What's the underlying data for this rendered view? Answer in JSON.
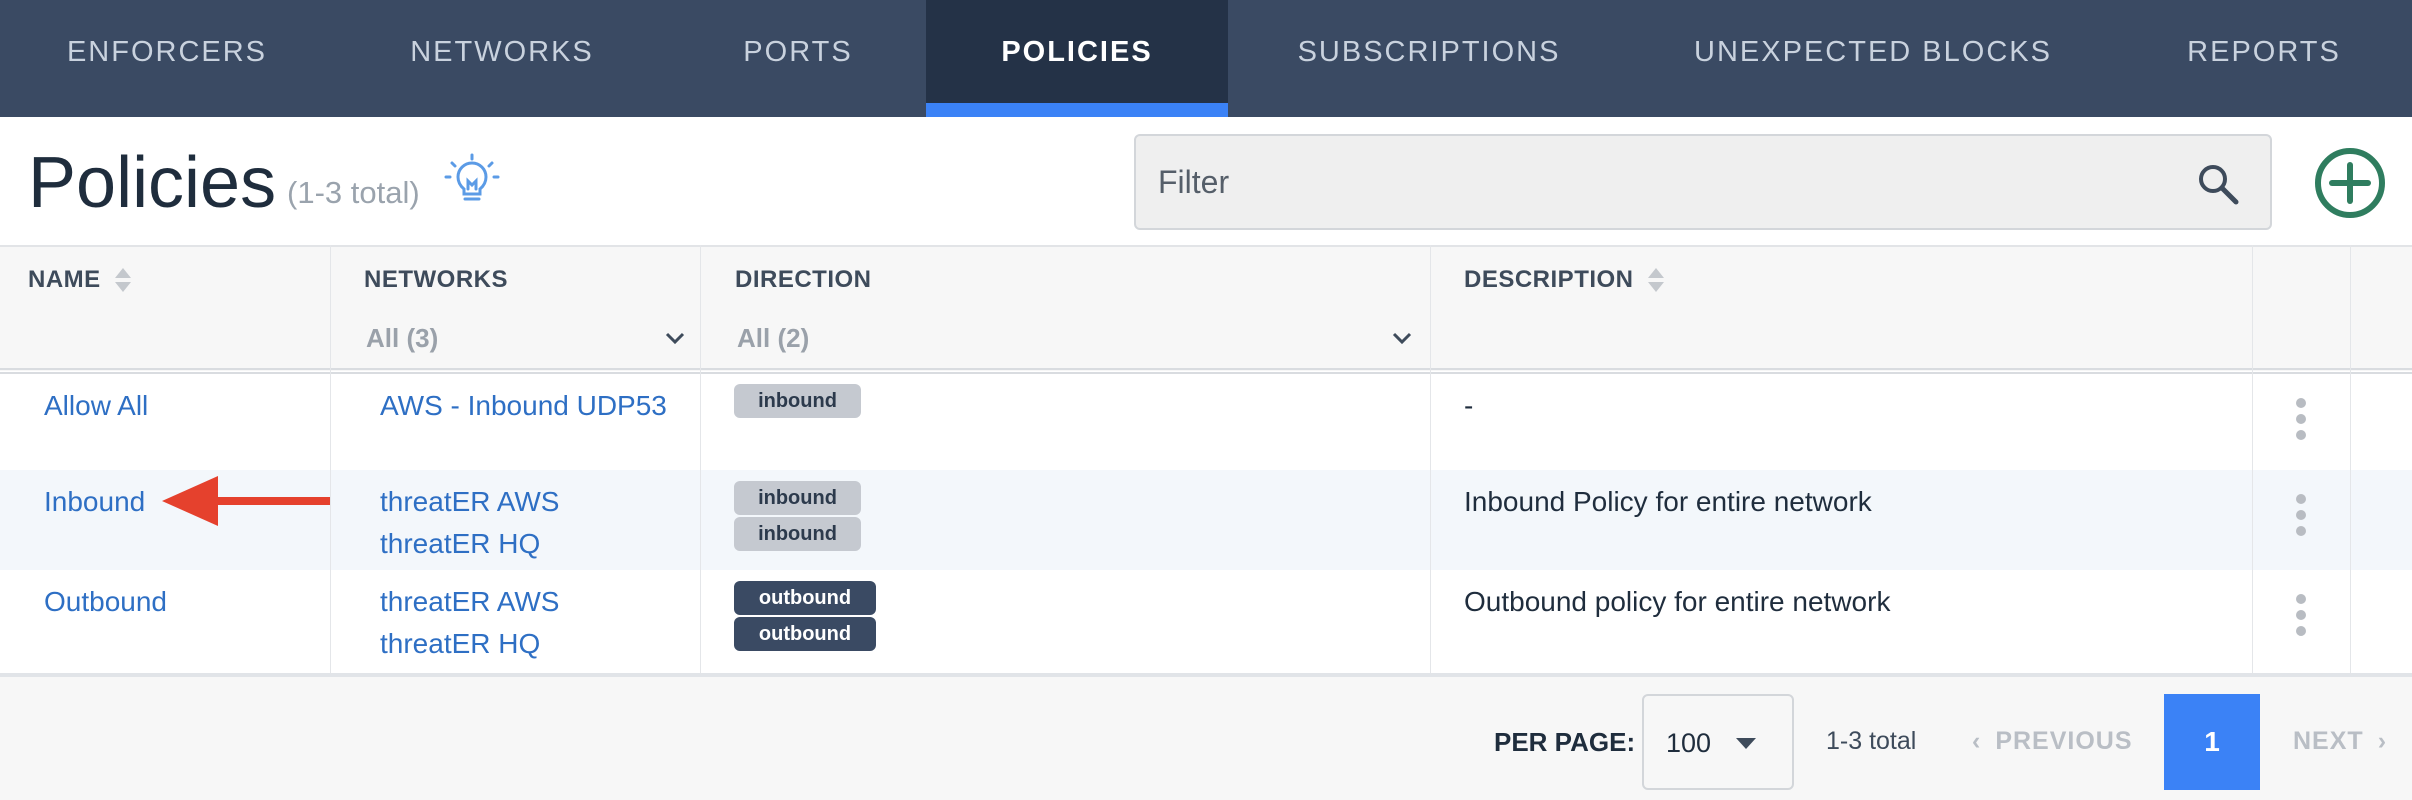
{
  "nav": {
    "tabs": [
      {
        "label": "ENFORCERS"
      },
      {
        "label": "NETWORKS"
      },
      {
        "label": "PORTS"
      },
      {
        "label": "POLICIES",
        "active": true
      },
      {
        "label": "SUBSCRIPTIONS"
      },
      {
        "label": "UNEXPECTED BLOCKS"
      },
      {
        "label": "REPORTS"
      }
    ]
  },
  "header": {
    "title": "Policies",
    "total": "(1-3 total)",
    "filter_placeholder": "Filter"
  },
  "table": {
    "columns": {
      "name": "NAME",
      "networks": "NETWORKS",
      "direction": "DIRECTION",
      "description": "DESCRIPTION"
    },
    "filters": {
      "networks": "All (3)",
      "direction": "All (2)"
    },
    "rows": [
      {
        "name": "Allow All",
        "networks": [
          "AWS - Inbound UDP53"
        ],
        "directions": [
          "inbound"
        ],
        "description": "-"
      },
      {
        "name": "Inbound",
        "networks": [
          "threatER AWS",
          "threatER HQ"
        ],
        "directions": [
          "inbound",
          "inbound"
        ],
        "description": "Inbound Policy for entire network"
      },
      {
        "name": "Outbound",
        "networks": [
          "threatER AWS",
          "threatER HQ"
        ],
        "directions": [
          "outbound",
          "outbound"
        ],
        "description": "Outbound policy for entire network"
      }
    ]
  },
  "footer": {
    "per_page_label": "PER PAGE:",
    "per_page_value": "100",
    "count": "1-3 total",
    "previous": "PREVIOUS",
    "page": "1",
    "next": "NEXT"
  },
  "colors": {
    "nav_bg": "#3a4a63",
    "nav_active": "#243247",
    "accent": "#3b82f6",
    "link": "#2e6fc4",
    "add_button": "#2f7d5f",
    "arrow": "#e5412d"
  },
  "icons": [
    "lightbulb-icon",
    "search-icon",
    "plus-circle-icon",
    "sort-icon",
    "chevron-down-icon",
    "kebab-icon",
    "arrow-left-icon"
  ]
}
